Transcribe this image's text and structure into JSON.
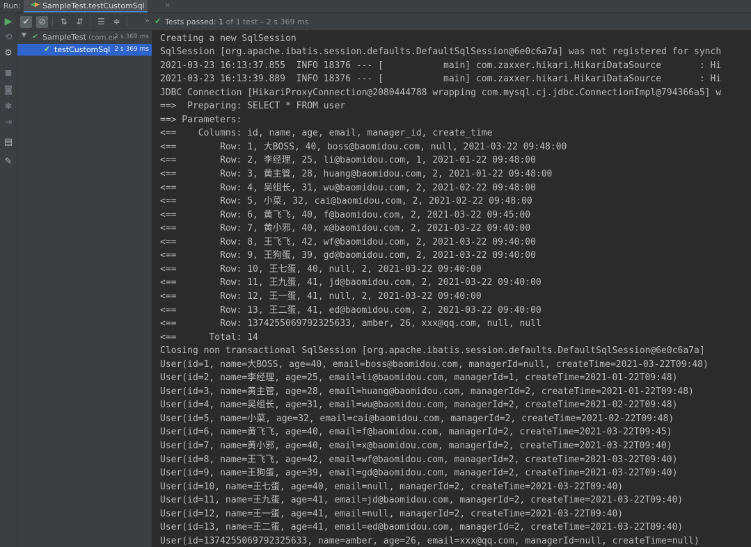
{
  "run_header": {
    "label": "Run:",
    "tab_label": "SampleTest.testCustomSql",
    "tab_close": "×"
  },
  "test_toolbar": {
    "chevron": "»",
    "status_prefix": "Tests passed: ",
    "status_count": "1",
    "status_suffix": " of 1 test – 2 s 369 ms"
  },
  "tree": {
    "items": [
      {
        "name": "SampleTest",
        "sub": " (com.ex·",
        "time": "2 s 369 ms",
        "expanded": true
      },
      {
        "name": "testCustomSql",
        "sub": "",
        "time": "2 s 369 ms",
        "selected": true
      }
    ]
  },
  "console": {
    "lines": [
      "Creating a new SqlSession",
      "SqlSession [org.apache.ibatis.session.defaults.DefaultSqlSession@6e0c6a7a] was not registered for synch",
      "2021-03-23 16:13:37.855  INFO 18376 --- [           main] com.zaxxer.hikari.HikariDataSource       : Hi",
      "2021-03-23 16:13:39.889  INFO 18376 --- [           main] com.zaxxer.hikari.HikariDataSource       : Hi",
      "JDBC Connection [HikariProxyConnection@2080444788 wrapping com.mysql.cj.jdbc.ConnectionImpl@794366a5] w",
      "==>  Preparing: SELECT * FROM user",
      "==> Parameters: ",
      "<==    Columns: id, name, age, email, manager_id, create_time",
      "<==        Row: 1, 大BOSS, 40, boss@baomidou.com, null, 2021-03-22 09:48:00",
      "<==        Row: 2, 李经理, 25, li@baomidou.com, 1, 2021-01-22 09:48:00",
      "<==        Row: 3, 黄主管, 28, huang@baomidou.com, 2, 2021-01-22 09:48:00",
      "<==        Row: 4, 吴组长, 31, wu@baomidou.com, 2, 2021-02-22 09:48:00",
      "<==        Row: 5, 小菜, 32, cai@baomidou.com, 2, 2021-02-22 09:48:00",
      "<==        Row: 6, 黄飞飞, 40, f@baomidou.com, 2, 2021-03-22 09:45:00",
      "<==        Row: 7, 黄小邪, 40, x@baomidou.com, 2, 2021-03-22 09:40:00",
      "<==        Row: 8, 王飞飞, 42, wf@baomidou.com, 2, 2021-03-22 09:40:00",
      "<==        Row: 9, 王狗蛋, 39, gd@baomidou.com, 2, 2021-03-22 09:40:00",
      "<==        Row: 10, 王七蛋, 40, null, 2, 2021-03-22 09:40:00",
      "<==        Row: 11, 王九蛋, 41, jd@baomidou.com, 2, 2021-03-22 09:40:00",
      "<==        Row: 12, 王一蛋, 41, null, 2, 2021-03-22 09:40:00",
      "<==        Row: 13, 王二蛋, 41, ed@baomidou.com, 2, 2021-03-22 09:40:00",
      "<==        Row: 1374255069792325633, amber, 26, xxx@qq.com, null, null",
      "<==      Total: 14",
      "Closing non transactional SqlSession [org.apache.ibatis.session.defaults.DefaultSqlSession@6e0c6a7a]",
      "User(id=1, name=大BOSS, age=40, email=boss@baomidou.com, managerId=null, createTime=2021-03-22T09:48)",
      "User(id=2, name=李经理, age=25, email=li@baomidou.com, managerId=1, createTime=2021-01-22T09:48)",
      "User(id=3, name=黄主管, age=28, email=huang@baomidou.com, managerId=2, createTime=2021-01-22T09:48)",
      "User(id=4, name=吴组长, age=31, email=wu@baomidou.com, managerId=2, createTime=2021-02-22T09:48)",
      "User(id=5, name=小菜, age=32, email=cai@baomidou.com, managerId=2, createTime=2021-02-22T09:48)",
      "User(id=6, name=黄飞飞, age=40, email=f@baomidou.com, managerId=2, createTime=2021-03-22T09:45)",
      "User(id=7, name=黄小邪, age=40, email=x@baomidou.com, managerId=2, createTime=2021-03-22T09:40)",
      "User(id=8, name=王飞飞, age=42, email=wf@baomidou.com, managerId=2, createTime=2021-03-22T09:40)",
      "User(id=9, name=王狗蛋, age=39, email=gd@baomidou.com, managerId=2, createTime=2021-03-22T09:40)",
      "User(id=10, name=王七蛋, age=40, email=null, managerId=2, createTime=2021-03-22T09:40)",
      "User(id=11, name=王九蛋, age=41, email=jd@baomidou.com, managerId=2, createTime=2021-03-22T09:40)",
      "User(id=12, name=王一蛋, age=41, email=null, managerId=2, createTime=2021-03-22T09:40)",
      "User(id=13, name=王二蛋, age=41, email=ed@baomidou.com, managerId=2, createTime=2021-03-22T09:40)",
      "User(id=1374255069792325633, name=amber, age=26, email=xxx@qq.com, managerId=null, createTime=null)"
    ]
  },
  "icons": {
    "left_toolbar": [
      "play-icon",
      "rerun-failed-icon",
      "debug-icon",
      "stop-icon",
      "camera-icon",
      "bug-icon",
      "exit-icon",
      "layout-icon",
      "pin-icon"
    ],
    "test_toolbar": [
      "show-passed-icon",
      "show-ignored-icon",
      "sort-alpha-icon",
      "sort-duration-icon",
      "expand-all-icon",
      "collapse-all-icon"
    ]
  },
  "colors": {
    "background": "#2b2b2b",
    "panel": "#3c3f41",
    "console_text": "#bbbbbb",
    "pass_green": "#59a869",
    "selection": "#2f65ca"
  }
}
